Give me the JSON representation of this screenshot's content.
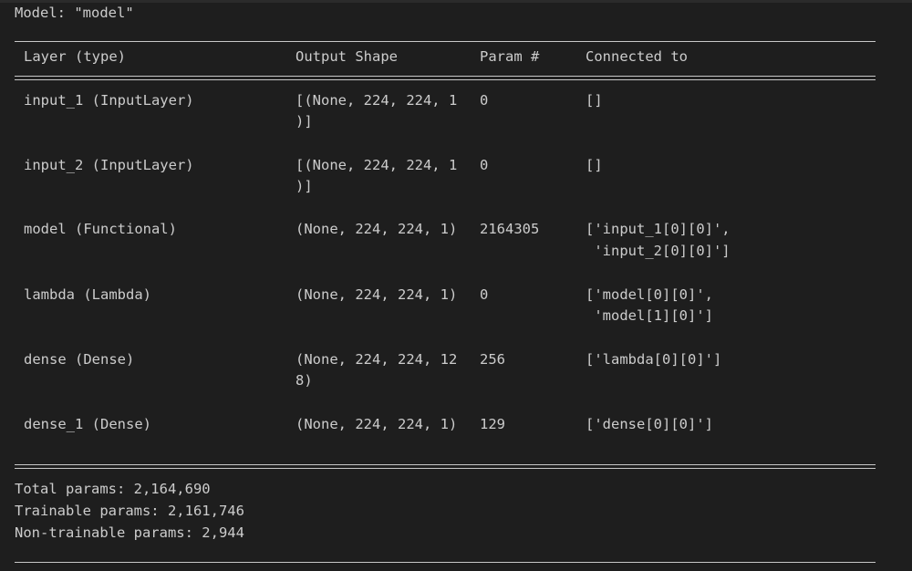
{
  "model_title": "Model: \"model\"",
  "headers": {
    "layer": "Layer (type)",
    "shape": "Output Shape",
    "param": "Param #",
    "connected": "Connected to"
  },
  "rows": [
    {
      "layer": "input_1 (InputLayer)",
      "shape_lines": [
        "[(None, 224, 224, 1",
        ")]"
      ],
      "param": "0",
      "connected_lines": [
        "[]"
      ]
    },
    {
      "layer": "input_2 (InputLayer)",
      "shape_lines": [
        "[(None, 224, 224, 1",
        ")]"
      ],
      "param": "0",
      "connected_lines": [
        "[]"
      ]
    },
    {
      "layer": "model (Functional)",
      "shape_lines": [
        "(None, 224, 224, 1)"
      ],
      "param": "2164305",
      "connected_lines": [
        "['input_1[0][0]',",
        " 'input_2[0][0]']"
      ]
    },
    {
      "layer": "lambda (Lambda)",
      "shape_lines": [
        "(None, 224, 224, 1)"
      ],
      "param": "0",
      "connected_lines": [
        "['model[0][0]',",
        " 'model[1][0]']"
      ]
    },
    {
      "layer": "dense (Dense)",
      "shape_lines": [
        "(None, 224, 224, 12",
        "8)"
      ],
      "param": "256",
      "connected_lines": [
        "['lambda[0][0]']"
      ]
    },
    {
      "layer": "dense_1 (Dense)",
      "shape_lines": [
        "(None, 224, 224, 1)"
      ],
      "param": "129",
      "connected_lines": [
        "['dense[0][0]']"
      ]
    }
  ],
  "summary": {
    "total": "Total params: 2,164,690",
    "trainable": "Trainable params: 2,161,746",
    "non_trainable": "Non-trainable params: 2,944"
  },
  "colors": {
    "background": "#1e1e1e",
    "text": "#cccccc",
    "rule": "#c8c8c8"
  }
}
